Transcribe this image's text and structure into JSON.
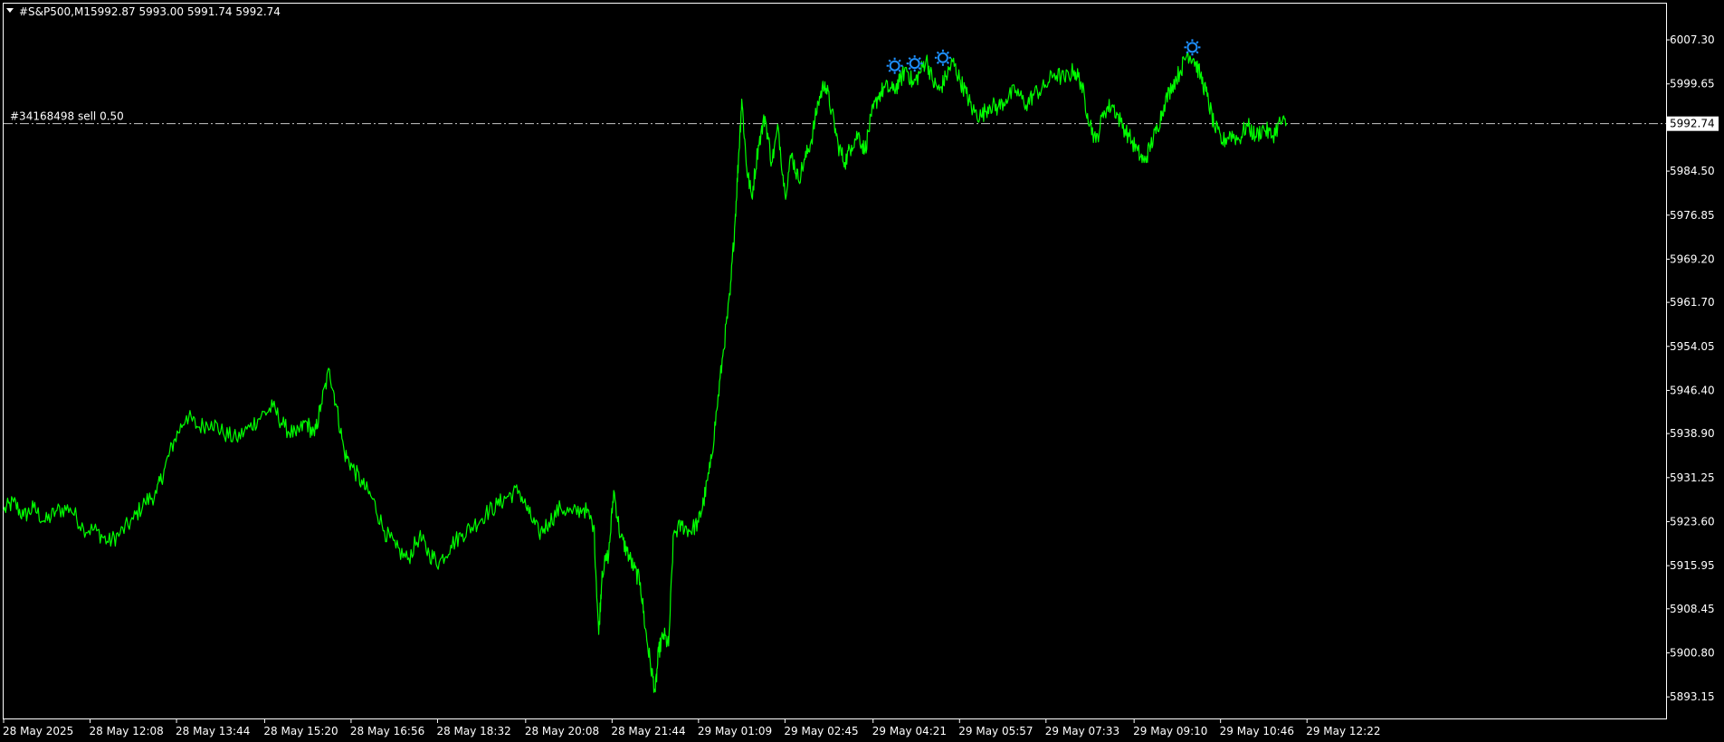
{
  "header": {
    "symbol": "#S&P500,M1",
    "ohlc": "5992.87 5993.00 5991.74 5992.74"
  },
  "order_line": {
    "label": "#34168498 sell 0.50",
    "price": 5992.74
  },
  "current_price_label": "5992.74",
  "colors": {
    "background": "#000000",
    "frame": "#ffffff",
    "price_line": "#00ff00",
    "marker": "#1e90ff",
    "order_line": "#c8c8c8"
  },
  "icons": [
    "dropdown-triangle-icon",
    "sun-marker-icon"
  ],
  "chart_data": {
    "type": "line",
    "title": "#S&P500,M1",
    "xlabel": "",
    "ylabel": "",
    "ylim": [
      5889.4,
      6013.6
    ],
    "grid": false,
    "y_ticks": [
      "6007.30",
      "5999.65",
      "5984.50",
      "5976.85",
      "5969.20",
      "5961.70",
      "5954.05",
      "5946.40",
      "5938.90",
      "5931.25",
      "5923.60",
      "5915.95",
      "5908.45",
      "5900.80",
      "5893.15"
    ],
    "x_ticks": [
      {
        "label": "28 May 2025",
        "t": 0
      },
      {
        "label": "28 May 12:08",
        "t": 0.052
      },
      {
        "label": "28 May 13:44",
        "t": 0.104
      },
      {
        "label": "28 May 15:20",
        "t": 0.157
      },
      {
        "label": "28 May 16:56",
        "t": 0.209
      },
      {
        "label": "28 May 18:32",
        "t": 0.261
      },
      {
        "label": "28 May 20:08",
        "t": 0.314
      },
      {
        "label": "28 May 21:44",
        "t": 0.366
      },
      {
        "label": "29 May 01:09",
        "t": 0.418
      },
      {
        "label": "29 May 02:45",
        "t": 0.47
      },
      {
        "label": "29 May 04:21",
        "t": 0.523
      },
      {
        "label": "29 May 05:57",
        "t": 0.575
      },
      {
        "label": "29 May 07:33",
        "t": 0.627
      },
      {
        "label": "29 May 09:10",
        "t": 0.68
      },
      {
        "label": "29 May 10:46",
        "t": 0.732
      },
      {
        "label": "29 May 12:22",
        "t": 0.784
      }
    ],
    "series": [
      {
        "name": "#S&P500,M1",
        "points": [
          [
            0.0,
            5925.5
          ],
          [
            0.006,
            5927.0
          ],
          [
            0.012,
            5924.5
          ],
          [
            0.018,
            5926.0
          ],
          [
            0.025,
            5923.5
          ],
          [
            0.032,
            5925.5
          ],
          [
            0.04,
            5926.0
          ],
          [
            0.048,
            5922.5
          ],
          [
            0.056,
            5922.0
          ],
          [
            0.063,
            5920.0
          ],
          [
            0.07,
            5921.5
          ],
          [
            0.078,
            5924.0
          ],
          [
            0.085,
            5927.0
          ],
          [
            0.092,
            5928.5
          ],
          [
            0.097,
            5933.0
          ],
          [
            0.103,
            5938.0
          ],
          [
            0.11,
            5942.0
          ],
          [
            0.117,
            5940.0
          ],
          [
            0.125,
            5941.0
          ],
          [
            0.132,
            5939.0
          ],
          [
            0.14,
            5938.0
          ],
          [
            0.148,
            5940.0
          ],
          [
            0.155,
            5942.0
          ],
          [
            0.162,
            5943.5
          ],
          [
            0.169,
            5940.0
          ],
          [
            0.176,
            5938.5
          ],
          [
            0.182,
            5941.0
          ],
          [
            0.187,
            5938.5
          ],
          [
            0.191,
            5944.0
          ],
          [
            0.196,
            5950.0
          ],
          [
            0.2,
            5944.0
          ],
          [
            0.205,
            5935.5
          ],
          [
            0.21,
            5933.0
          ],
          [
            0.216,
            5930.0
          ],
          [
            0.222,
            5927.5
          ],
          [
            0.229,
            5922.0
          ],
          [
            0.236,
            5919.0
          ],
          [
            0.243,
            5917.0
          ],
          [
            0.25,
            5921.0
          ],
          [
            0.256,
            5918.0
          ],
          [
            0.262,
            5916.5
          ],
          [
            0.269,
            5919.5
          ],
          [
            0.276,
            5921.5
          ],
          [
            0.283,
            5923.0
          ],
          [
            0.29,
            5925.0
          ],
          [
            0.297,
            5926.5
          ],
          [
            0.303,
            5928.0
          ],
          [
            0.31,
            5929.0
          ],
          [
            0.316,
            5925.0
          ],
          [
            0.322,
            5921.5
          ],
          [
            0.328,
            5923.5
          ],
          [
            0.335,
            5926.0
          ],
          [
            0.342,
            5925.0
          ],
          [
            0.349,
            5926.0
          ],
          [
            0.355,
            5923.0
          ],
          [
            0.358,
            5904.0
          ],
          [
            0.36,
            5915.0
          ],
          [
            0.364,
            5918.0
          ],
          [
            0.367,
            5929.0
          ],
          [
            0.371,
            5921.0
          ],
          [
            0.375,
            5918.5
          ],
          [
            0.379,
            5915.5
          ],
          [
            0.383,
            5913.0
          ],
          [
            0.386,
            5905.0
          ],
          [
            0.389,
            5899.0
          ],
          [
            0.392,
            5894.0
          ],
          [
            0.394,
            5901.0
          ],
          [
            0.397,
            5904.0
          ],
          [
            0.4,
            5902.0
          ],
          [
            0.403,
            5921.5
          ],
          [
            0.408,
            5923.0
          ],
          [
            0.413,
            5922.0
          ],
          [
            0.418,
            5923.5
          ],
          [
            0.421,
            5927.0
          ],
          [
            0.425,
            5933.0
          ],
          [
            0.429,
            5943.0
          ],
          [
            0.433,
            5953.5
          ],
          [
            0.437,
            5963.0
          ],
          [
            0.44,
            5976.0
          ],
          [
            0.442,
            5986.5
          ],
          [
            0.444,
            5997.0
          ],
          [
            0.447,
            5985.0
          ],
          [
            0.45,
            5980.0
          ],
          [
            0.454,
            5989.0
          ],
          [
            0.458,
            5994.0
          ],
          [
            0.462,
            5986.0
          ],
          [
            0.466,
            5992.0
          ],
          [
            0.47,
            5980.5
          ],
          [
            0.474,
            5987.5
          ],
          [
            0.478,
            5983.0
          ],
          [
            0.482,
            5986.5
          ],
          [
            0.486,
            5990.0
          ],
          [
            0.49,
            5996.5
          ],
          [
            0.494,
            6000.0
          ],
          [
            0.498,
            5995.0
          ],
          [
            0.502,
            5989.0
          ],
          [
            0.506,
            5986.0
          ],
          [
            0.51,
            5989.0
          ],
          [
            0.514,
            5991.0
          ],
          [
            0.518,
            5988.0
          ],
          [
            0.522,
            5994.0
          ],
          [
            0.526,
            5997.5
          ],
          [
            0.53,
            5999.0
          ],
          [
            0.535,
            5998.5
          ],
          [
            0.539,
            6000.0
          ],
          [
            0.543,
            6002.5
          ],
          [
            0.547,
            5999.5
          ],
          [
            0.551,
            6001.5
          ],
          [
            0.555,
            6004.0
          ],
          [
            0.559,
            6000.0
          ],
          [
            0.563,
            5998.5
          ],
          [
            0.567,
            6001.0
          ],
          [
            0.571,
            6003.5
          ],
          [
            0.575,
            6000.5
          ],
          [
            0.579,
            5998.0
          ],
          [
            0.583,
            5995.0
          ],
          [
            0.588,
            5994.0
          ],
          [
            0.593,
            5996.0
          ],
          [
            0.598,
            5995.5
          ],
          [
            0.603,
            5997.0
          ],
          [
            0.609,
            5998.5
          ],
          [
            0.615,
            5996.0
          ],
          [
            0.62,
            5998.0
          ],
          [
            0.626,
            5999.0
          ],
          [
            0.632,
            6001.5
          ],
          [
            0.638,
            6000.5
          ],
          [
            0.644,
            6002.0
          ],
          [
            0.648,
            6000.0
          ],
          [
            0.652,
            5994.5
          ],
          [
            0.657,
            5989.5
          ],
          [
            0.662,
            5995.0
          ],
          [
            0.667,
            5996.0
          ],
          [
            0.672,
            5993.0
          ],
          [
            0.677,
            5990.5
          ],
          [
            0.682,
            5988.0
          ],
          [
            0.686,
            5986.0
          ],
          [
            0.69,
            5989.0
          ],
          [
            0.694,
            5992.0
          ],
          [
            0.698,
            5996.0
          ],
          [
            0.703,
            5999.5
          ],
          [
            0.708,
            6002.0
          ],
          [
            0.712,
            6005.0
          ],
          [
            0.716,
            6004.0
          ],
          [
            0.72,
            6001.0
          ],
          [
            0.724,
            5997.5
          ],
          [
            0.728,
            5992.5
          ],
          [
            0.733,
            5989.5
          ],
          [
            0.738,
            5991.0
          ],
          [
            0.743,
            5990.0
          ],
          [
            0.748,
            5992.5
          ],
          [
            0.753,
            5990.5
          ],
          [
            0.758,
            5992.0
          ],
          [
            0.763,
            5990.5
          ],
          [
            0.768,
            5993.0
          ],
          [
            0.772,
            5992.74
          ]
        ]
      }
    ],
    "markers": [
      {
        "t": 0.536,
        "price": 6002.8
      },
      {
        "t": 0.548,
        "price": 6003.2
      },
      {
        "t": 0.565,
        "price": 6004.2
      },
      {
        "t": 0.715,
        "price": 6006.0
      }
    ]
  }
}
